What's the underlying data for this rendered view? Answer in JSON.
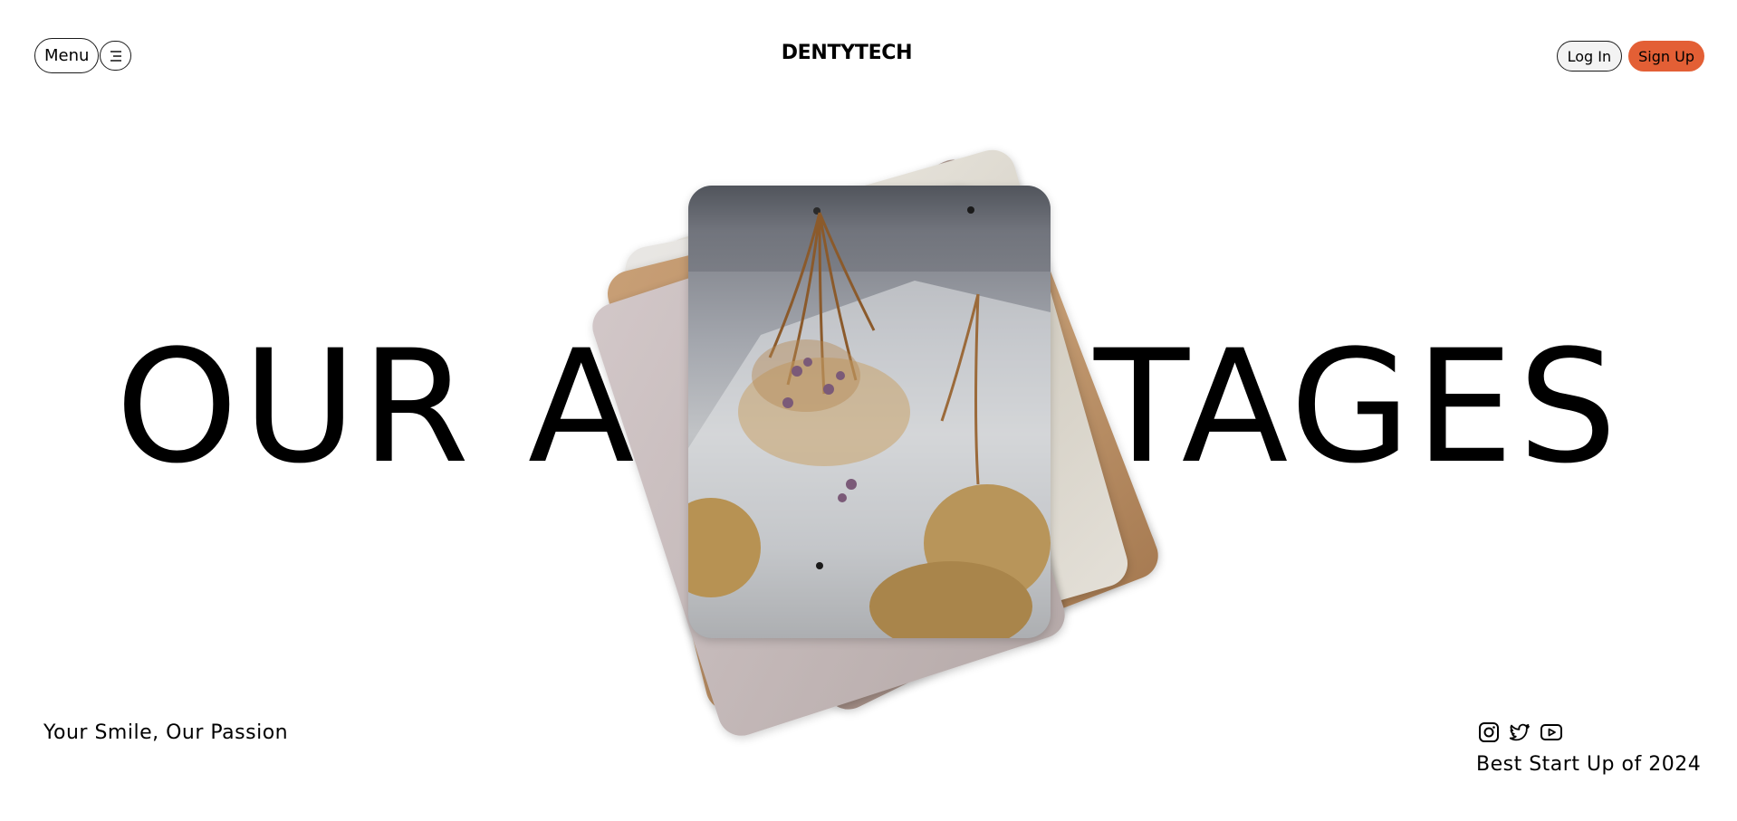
{
  "header": {
    "menu_label": "Menu",
    "brand": "DENTYTECH",
    "login_label": "Log In",
    "signup_label": "Sign Up"
  },
  "hero": {
    "headline": "OUR ADVANTAGES"
  },
  "footer": {
    "tagline": "Your Smile, Our Passion",
    "award": "Best Start Up of 2024",
    "social_icons": [
      "instagram-icon",
      "twitter-icon",
      "youtube-icon"
    ]
  },
  "colors": {
    "accent": "#e35f35",
    "text": "#000000",
    "background": "#ffffff"
  }
}
